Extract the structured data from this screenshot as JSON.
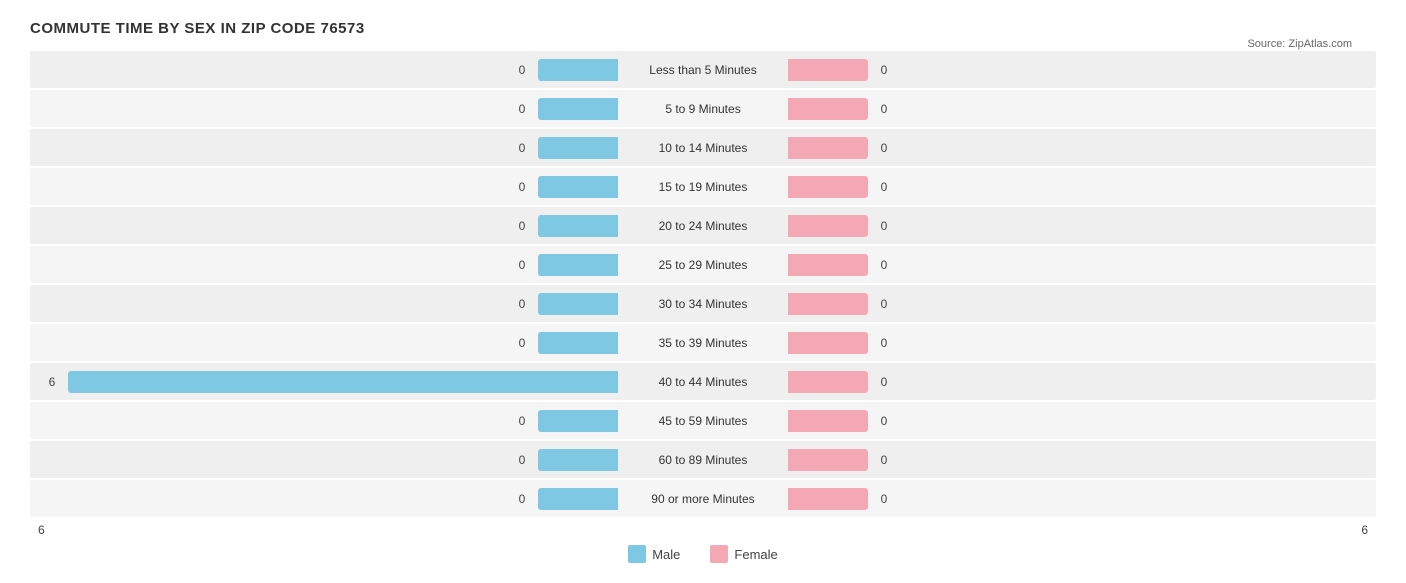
{
  "title": "COMMUTE TIME BY SEX IN ZIP CODE 76573",
  "source": "Source: ZipAtlas.com",
  "axis": {
    "left": "6",
    "right": "6"
  },
  "legend": {
    "male_label": "Male",
    "female_label": "Female",
    "male_color": "#7EC8E3",
    "female_color": "#F4A8B5"
  },
  "rows": [
    {
      "label": "Less than 5 Minutes",
      "male": 0,
      "female": 0,
      "male_bar": 80,
      "female_bar": 80
    },
    {
      "label": "5 to 9 Minutes",
      "male": 0,
      "female": 0,
      "male_bar": 80,
      "female_bar": 80
    },
    {
      "label": "10 to 14 Minutes",
      "male": 0,
      "female": 0,
      "male_bar": 80,
      "female_bar": 80
    },
    {
      "label": "15 to 19 Minutes",
      "male": 0,
      "female": 0,
      "male_bar": 80,
      "female_bar": 80
    },
    {
      "label": "20 to 24 Minutes",
      "male": 0,
      "female": 0,
      "male_bar": 80,
      "female_bar": 80
    },
    {
      "label": "25 to 29 Minutes",
      "male": 0,
      "female": 0,
      "male_bar": 80,
      "female_bar": 80
    },
    {
      "label": "30 to 34 Minutes",
      "male": 0,
      "female": 0,
      "male_bar": 80,
      "female_bar": 80
    },
    {
      "label": "35 to 39 Minutes",
      "male": 0,
      "female": 0,
      "male_bar": 80,
      "female_bar": 80
    },
    {
      "label": "40 to 44 Minutes",
      "male": 6,
      "female": 0,
      "male_bar": 560,
      "female_bar": 80
    },
    {
      "label": "45 to 59 Minutes",
      "male": 0,
      "female": 0,
      "male_bar": 80,
      "female_bar": 80
    },
    {
      "label": "60 to 89 Minutes",
      "male": 0,
      "female": 0,
      "male_bar": 80,
      "female_bar": 80
    },
    {
      "label": "90 or more Minutes",
      "male": 0,
      "female": 0,
      "male_bar": 80,
      "female_bar": 80
    }
  ]
}
